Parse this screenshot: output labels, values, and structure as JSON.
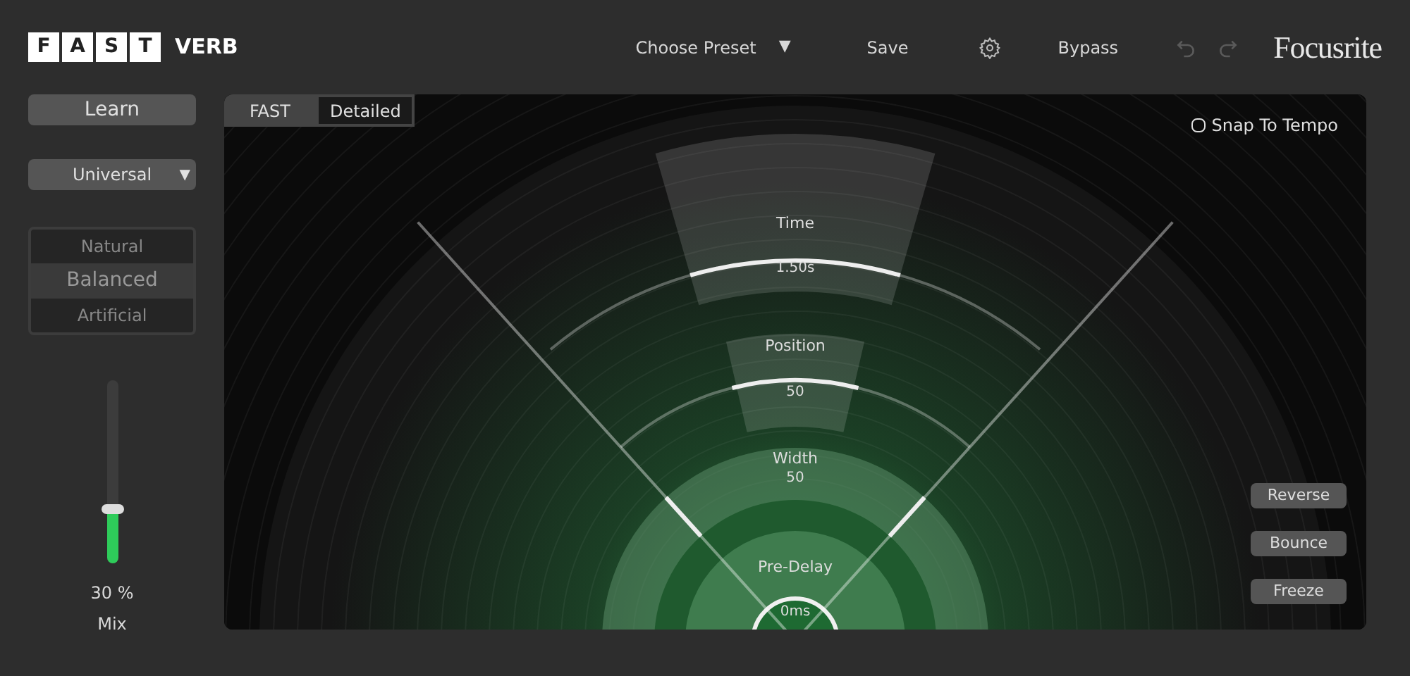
{
  "header": {
    "logo_letters": [
      "F",
      "A",
      "S",
      "T"
    ],
    "logo_word": "VERB",
    "preset": {
      "label": "Choose Preset",
      "caret": "▼"
    },
    "save": "Save",
    "bypass": "Bypass",
    "undo": {
      "disabled": true
    },
    "redo": {
      "disabled": true
    },
    "brand": "Focusrite"
  },
  "sidebar": {
    "learn": "Learn",
    "source": {
      "value": "Universal",
      "caret": "▼"
    },
    "styles": [
      {
        "label": "Natural",
        "selected": false
      },
      {
        "label": "Balanced",
        "selected": true
      },
      {
        "label": "Artificial",
        "selected": false
      }
    ],
    "mix": {
      "level": 0.3,
      "reading": "30 %",
      "label": "Mix"
    }
  },
  "main": {
    "tabs": [
      {
        "label": "FAST",
        "selected": false
      },
      {
        "label": "Detailed",
        "selected": true
      }
    ],
    "snap_to_tempo": {
      "label": "Snap To Tempo",
      "checked": false
    },
    "params": [
      {
        "label": "Time",
        "value": "1.50s"
      },
      {
        "label": "Position",
        "value": "50"
      },
      {
        "label": "Width",
        "value": "50"
      },
      {
        "label": "Pre-Delay",
        "value": "0ms"
      }
    ],
    "buttons": [
      "Reverse",
      "Bounce",
      "Freeze"
    ]
  }
}
